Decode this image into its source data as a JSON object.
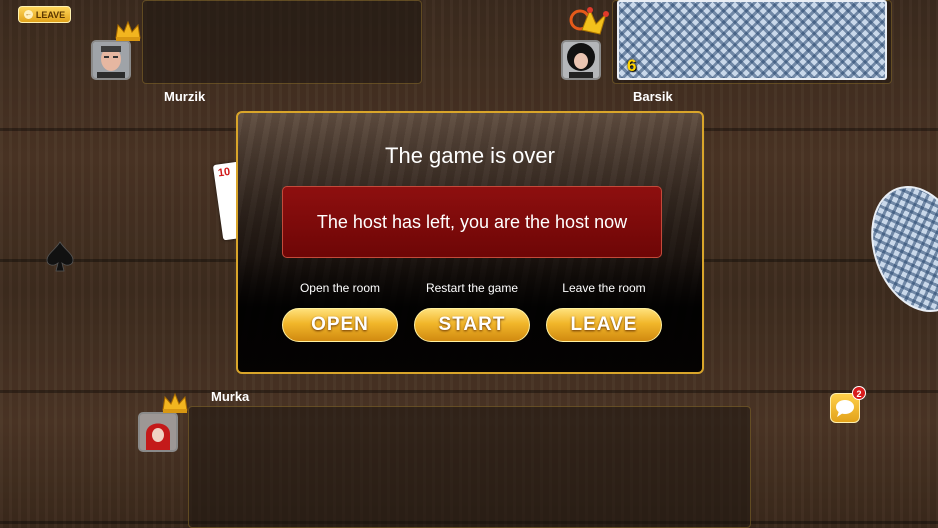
{
  "header": {
    "leave_label": "LEAVE"
  },
  "players": {
    "top_left": {
      "name": "Murzik"
    },
    "top_right": {
      "name": "Barsik",
      "card_count": "6"
    },
    "bottom": {
      "name": "Murka"
    }
  },
  "table": {
    "visible_card_rank": "10"
  },
  "dialog": {
    "title": "The game is over",
    "message": "The host has left, you are the host now",
    "options": [
      {
        "label": "Open the room",
        "button": "OPEN"
      },
      {
        "label": "Restart the game",
        "button": "START"
      },
      {
        "label": "Leave the room",
        "button": "LEAVE"
      }
    ]
  },
  "chat": {
    "unread_count": "2"
  },
  "colors": {
    "gold": "#f1b62a",
    "dialog_border": "#d9a52a",
    "message_bg": "#8e0f0f",
    "trump_suit": "spade"
  }
}
